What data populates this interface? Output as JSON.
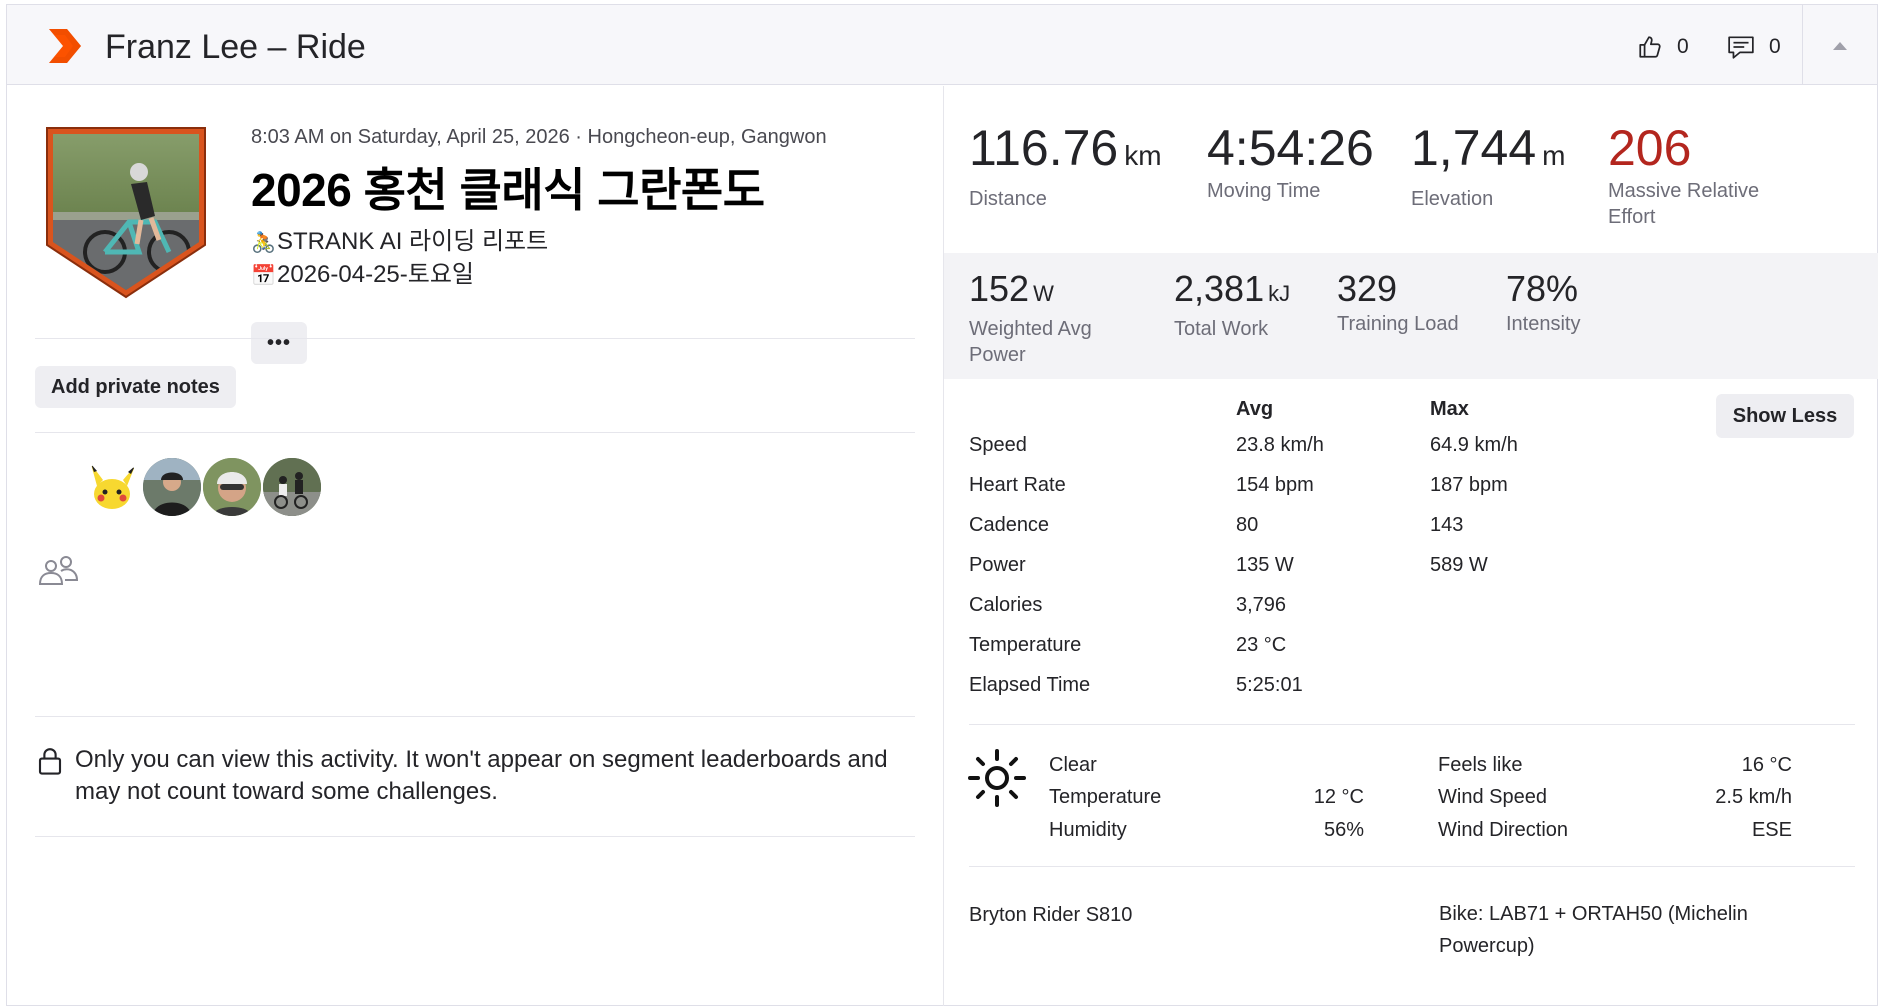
{
  "header": {
    "title": "Franz Lee – Ride",
    "kudos_count": "0",
    "comments_count": "0",
    "brand_color": "#fc5200"
  },
  "activity": {
    "meta": "8:03 AM on Saturday, April 25, 2026 · Hongcheon-eup, Gangwon",
    "title": "2026 홍천 클래식 그란폰도",
    "description_lines": [
      {
        "emoji": "🚴",
        "text": "STRANK AI 라이딩 리포트"
      },
      {
        "emoji": "📅",
        "text": "2026-04-25-토요일"
      }
    ],
    "more_label": "•••",
    "notes_label": "Add private notes",
    "privacy_text": "Only you can view this activity. It won't appear on segment leaderboards and may not count toward some challenges."
  },
  "stats_primary": [
    {
      "value": "116.76",
      "unit": "km",
      "label": "Distance"
    },
    {
      "value": "4:54:26",
      "unit": "",
      "label": "Moving Time"
    },
    {
      "value": "1,744",
      "unit": "m",
      "label": "Elevation"
    },
    {
      "value": "206",
      "unit": "",
      "label": "Massive Relative Effort",
      "label_lines": [
        "Massive Relative",
        "Effort"
      ]
    }
  ],
  "stats_secondary": [
    {
      "value": "152",
      "unit": "W",
      "label": "Weighted Avg Power",
      "label_lines": [
        "Weighted Avg",
        "Power"
      ]
    },
    {
      "value": "2,381",
      "unit": "kJ",
      "label": "Total Work"
    },
    {
      "value": "329",
      "unit": "",
      "label": "Training Load"
    },
    {
      "value": "78%",
      "unit": "",
      "label": "Intensity"
    }
  ],
  "table": {
    "col_avg": "Avg",
    "col_max": "Max",
    "show_less": "Show Less",
    "rows": [
      {
        "label": "Speed",
        "avg": "23.8 km/h",
        "max": "64.9 km/h"
      },
      {
        "label": "Heart Rate",
        "avg": "154 bpm",
        "max": "187 bpm"
      },
      {
        "label": "Cadence",
        "avg": "80",
        "max": "143"
      },
      {
        "label": "Power",
        "avg": "135 W",
        "max": "589 W"
      },
      {
        "label": "Calories",
        "avg": "3,796",
        "max": ""
      },
      {
        "label": "Temperature",
        "avg": "23 °C",
        "max": ""
      },
      {
        "label": "Elapsed Time",
        "avg": "5:25:01",
        "max": ""
      }
    ]
  },
  "weather": {
    "condition": "Clear",
    "temperature_label": "Temperature",
    "temperature": "12 °C",
    "humidity_label": "Humidity",
    "humidity": "56%",
    "feels_like_label": "Feels like",
    "feels_like": "16 °C",
    "wind_speed_label": "Wind Speed",
    "wind_speed": "2.5 km/h",
    "wind_direction_label": "Wind Direction",
    "wind_direction": "ESE"
  },
  "gear": {
    "device": "Bryton Rider S810",
    "bike_lines": [
      "Bike: LAB71 + ORTAH50 (Michelin",
      "Powercup)"
    ]
  }
}
